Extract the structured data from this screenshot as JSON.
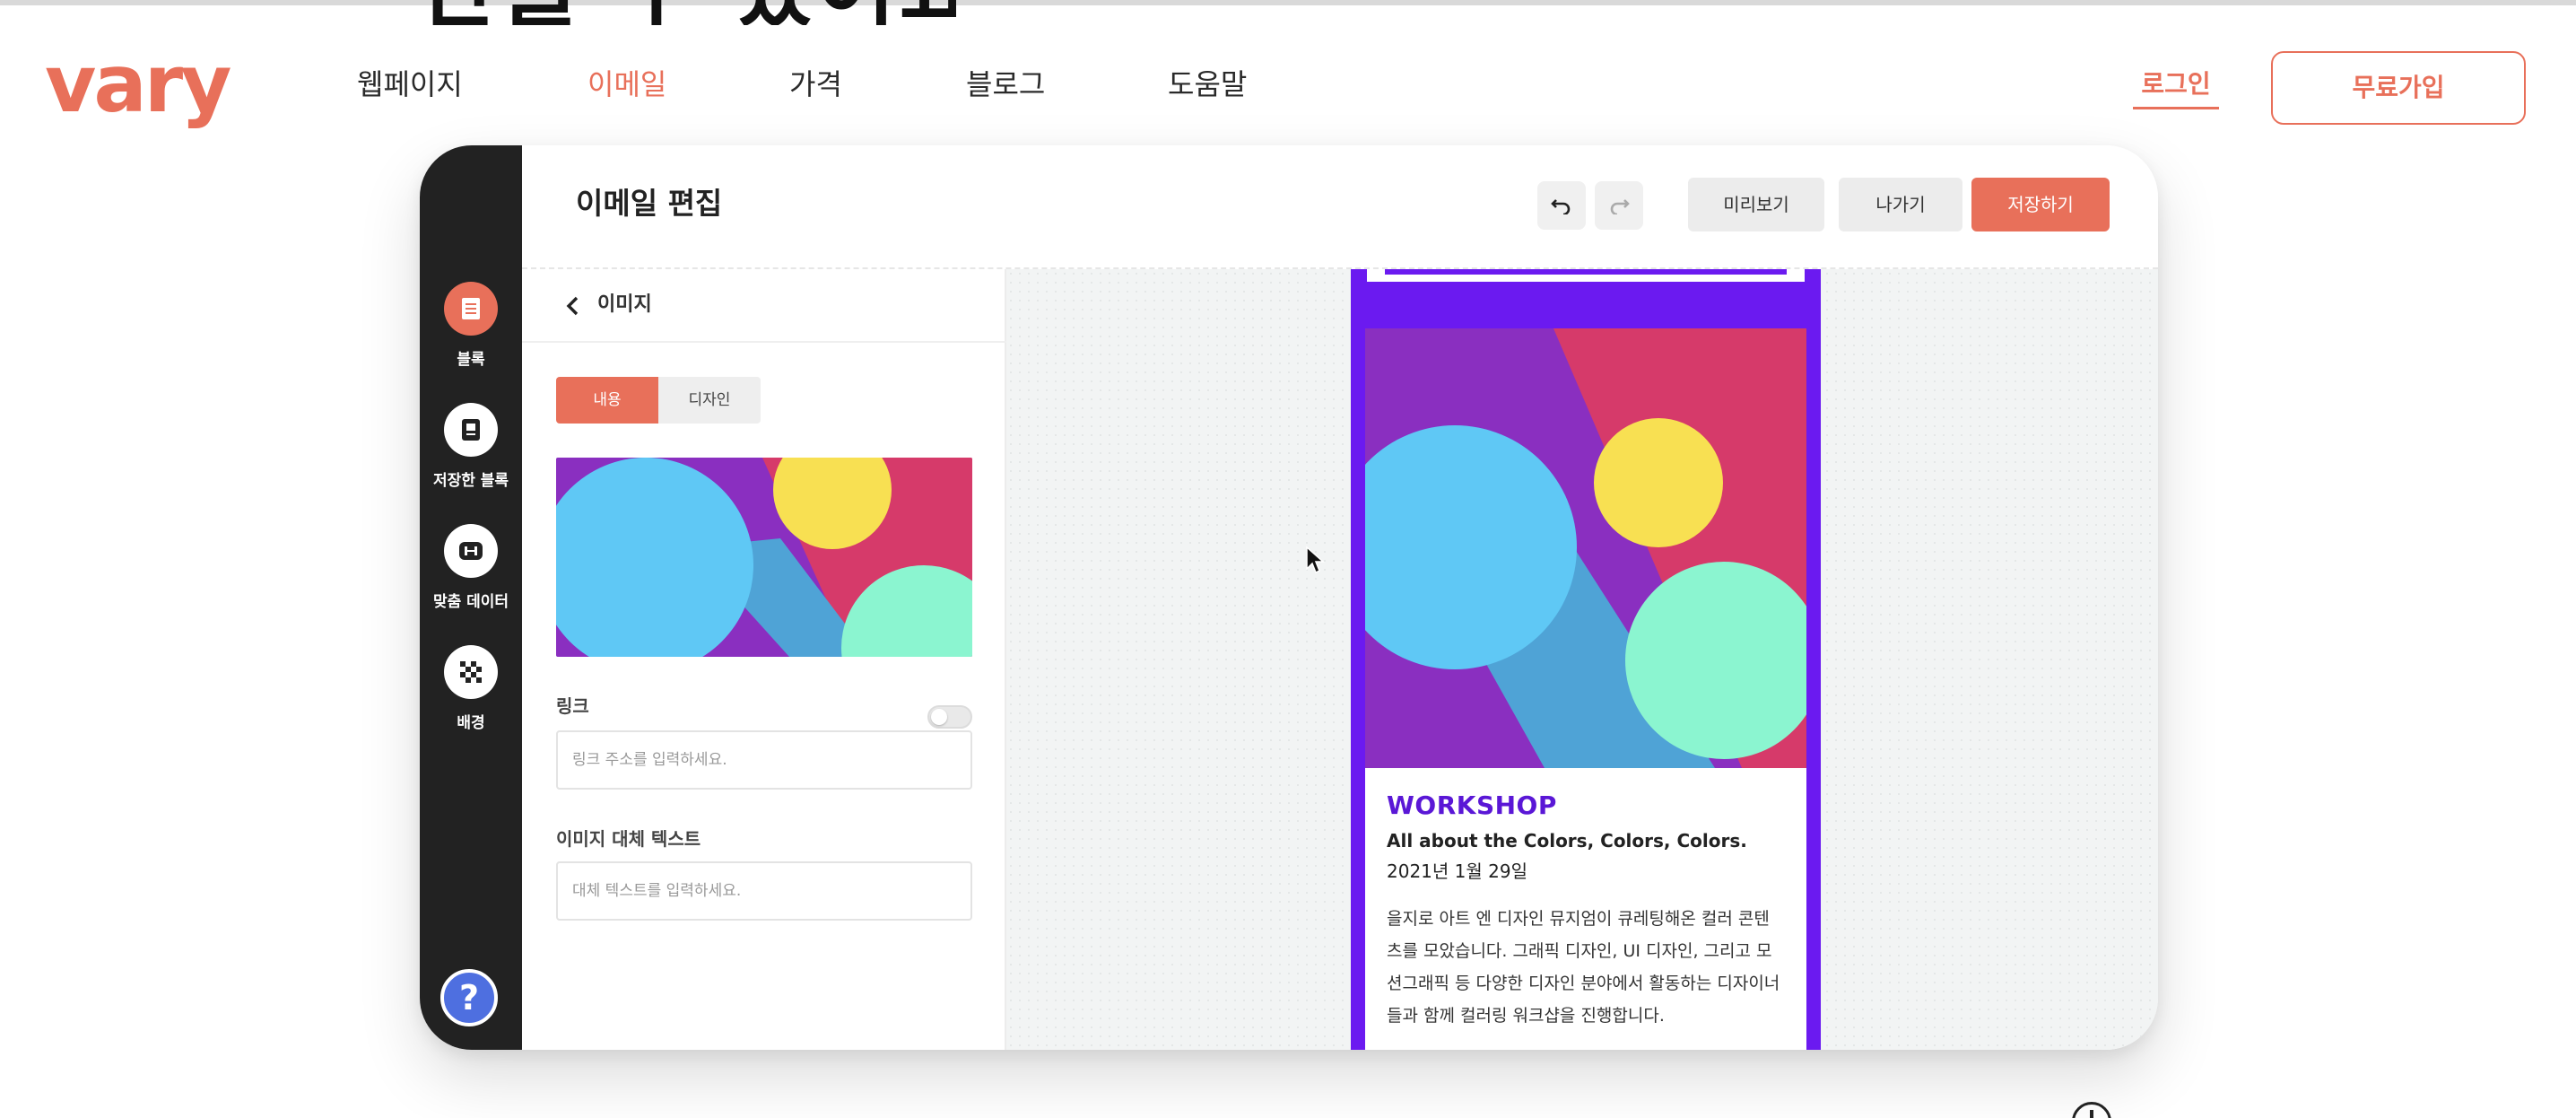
{
  "site": {
    "heading_fragment": "만들 수 있어요",
    "logo": "vary",
    "nav": [
      {
        "label": "웹페이지",
        "active": false
      },
      {
        "label": "이메일",
        "active": true
      },
      {
        "label": "가격",
        "active": false
      },
      {
        "label": "블로그",
        "active": false
      },
      {
        "label": "도움말",
        "active": false
      }
    ],
    "login_label": "로그인",
    "signup_label": "무료가입",
    "accent_color": "#e8705a"
  },
  "editor": {
    "title": "이메일 편집",
    "toolbar": {
      "undo_icon": "undo-icon",
      "redo_icon": "redo-icon",
      "preview_label": "미리보기",
      "exit_label": "나가기",
      "save_label": "저장하기"
    },
    "sidebar": {
      "items": [
        {
          "label": "블록",
          "icon": "document-icon",
          "active": true
        },
        {
          "label": "저장한 블록",
          "icon": "saved-block-icon",
          "active": false
        },
        {
          "label": "맞춤 데이터",
          "icon": "custom-data-icon",
          "active": false
        },
        {
          "label": "배경",
          "icon": "checker-icon",
          "active": false
        }
      ],
      "help_label": "?"
    },
    "panel": {
      "title": "이미지",
      "tabs": [
        {
          "label": "내용",
          "active": true
        },
        {
          "label": "디자인",
          "active": false
        }
      ],
      "link_label": "링크",
      "link_placeholder": "링크 주소를 입력하세요.",
      "link_toggle_on": false,
      "alt_label": "이미지 대체 텍스트",
      "alt_placeholder": "대체 텍스트를 입력하세요."
    },
    "email_preview": {
      "frame_color": "#6b1af0",
      "title": "WORKSHOP",
      "subtitle": "All about the Colors, Colors, Colors.",
      "date": "2021년 1월 29일",
      "body": "을지로 아트 엔 디자인 뮤지엄이 큐레팅해온 컬러 콘텐츠를 모았습니다. 그래픽 디자인, UI 디자인, 그리고 모션그래픽 등 다양한 디자인 분야에서 활동하는 디자이너들과 함께 컬러링 워크샵을 진행합니다."
    }
  }
}
